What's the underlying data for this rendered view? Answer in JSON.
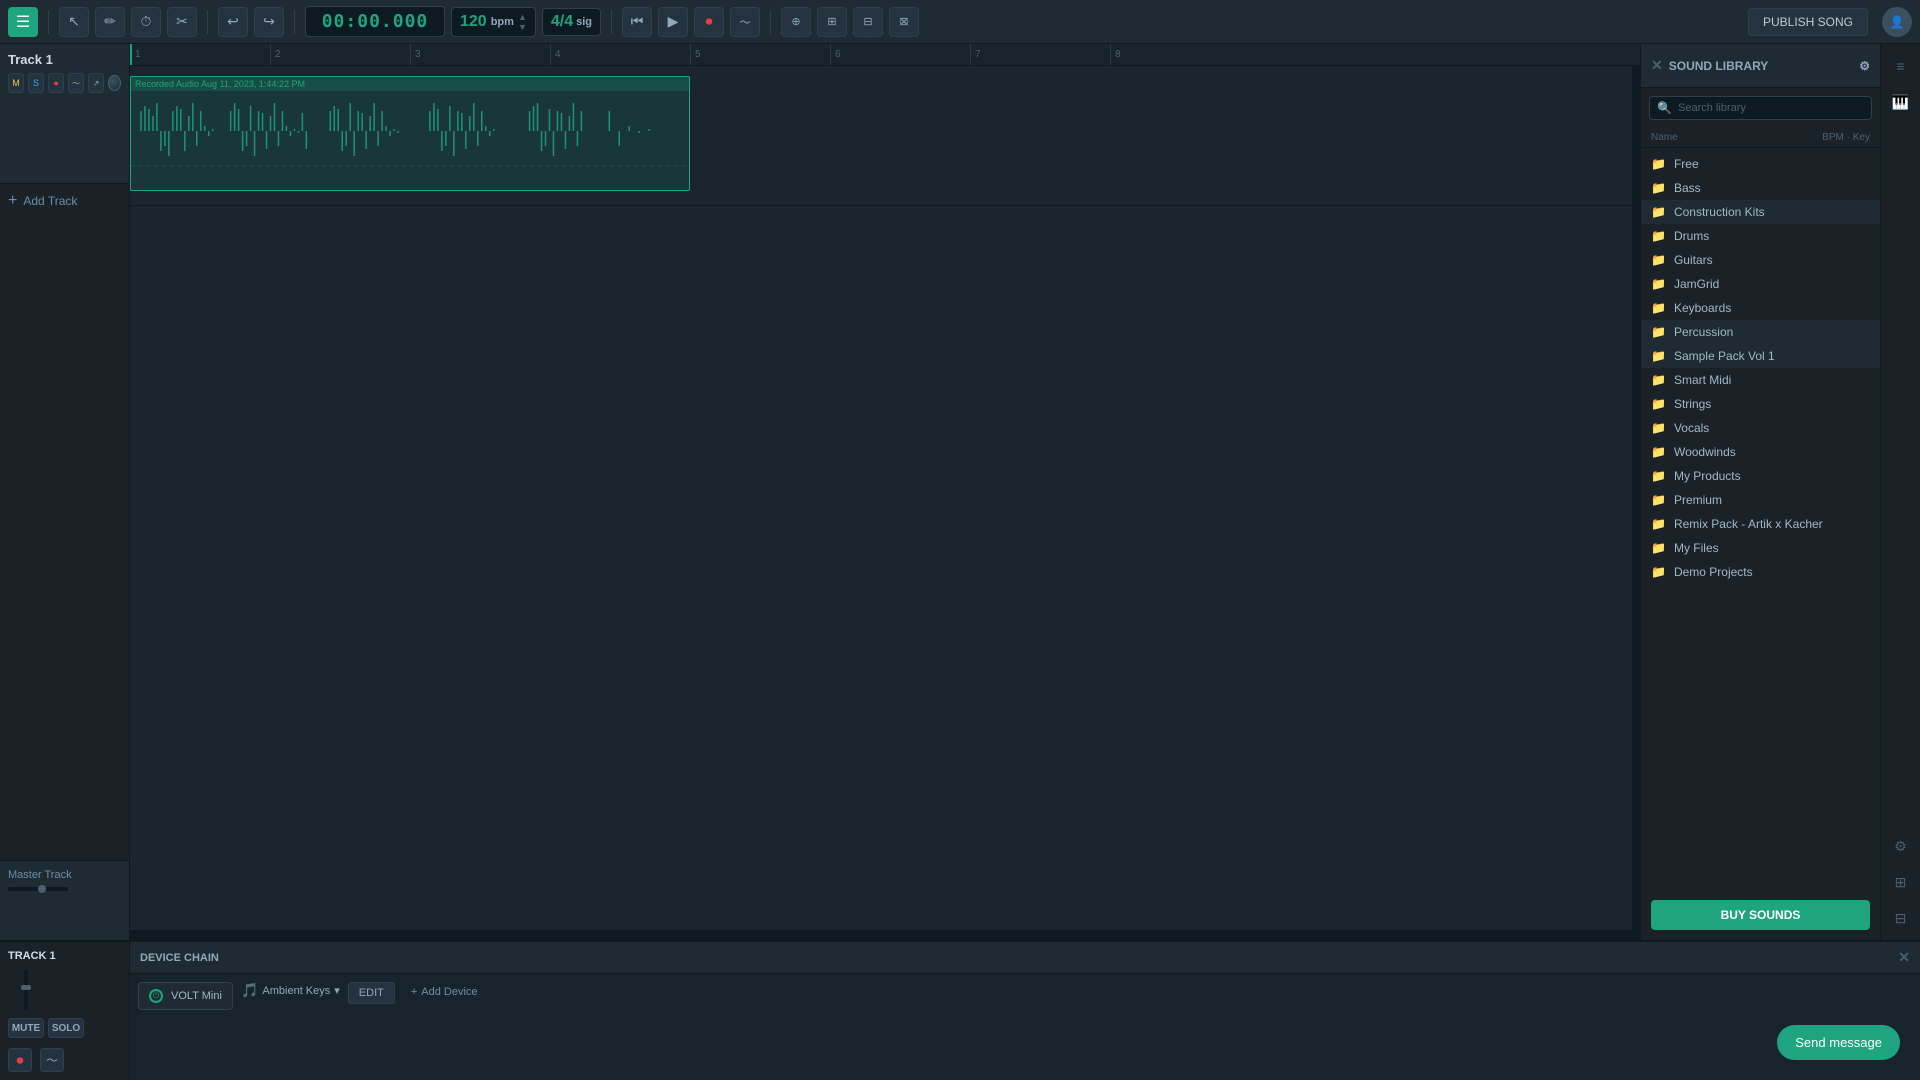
{
  "toolbar": {
    "menu_icon": "☰",
    "tools": [
      {
        "name": "select-tool",
        "icon": "↖",
        "label": "Select"
      },
      {
        "name": "pencil-tool",
        "icon": "✏",
        "label": "Pencil"
      },
      {
        "name": "clock-tool",
        "icon": "⏱",
        "label": "Clock"
      },
      {
        "name": "cut-tool",
        "icon": "✂",
        "label": "Cut"
      },
      {
        "name": "undo-btn",
        "icon": "↩",
        "label": "Undo"
      },
      {
        "name": "redo-btn",
        "icon": "↪",
        "label": "Redo"
      }
    ],
    "transport_time": "00:00.000",
    "bpm": "120",
    "bpm_unit": "bpm",
    "time_sig": "4/4",
    "time_sig_unit": "sig",
    "transport_btns": [
      {
        "name": "go-start-btn",
        "icon": "⏮"
      },
      {
        "name": "play-btn",
        "icon": "▶"
      },
      {
        "name": "record-btn",
        "icon": "⏺"
      },
      {
        "name": "loop-btn",
        "icon": "🔁"
      }
    ],
    "extra_tools": [
      {
        "name": "tool-a",
        "icon": "⊕"
      },
      {
        "name": "tool-b",
        "icon": "⊞"
      },
      {
        "name": "tool-c",
        "icon": "⊟"
      },
      {
        "name": "tool-d",
        "icon": "⊠"
      }
    ],
    "publish_label": "PUBLISH SONG"
  },
  "track1": {
    "name": "Track 1",
    "clip_label": "Recorded Audio Aug 11, 2023, 1:44:22 PM",
    "controls": {
      "m": "M",
      "s": "S",
      "rec": "●",
      "eq": "〜",
      "auto": "↗"
    }
  },
  "add_track_label": "Add Track",
  "master_track_label": "Master Track",
  "timeline": {
    "marks": [
      "1",
      "2",
      "3",
      "4",
      "5",
      "6",
      "7",
      "8"
    ]
  },
  "sound_library": {
    "title": "SOUND LIBRARY",
    "search_placeholder": "Search library",
    "columns": {
      "name": "Name",
      "bpm": "BPM",
      "key": "Key"
    },
    "items": [
      {
        "name": "Free",
        "type": "folder"
      },
      {
        "name": "Bass",
        "type": "folder"
      },
      {
        "name": "Construction Kits",
        "type": "folder"
      },
      {
        "name": "Drums",
        "type": "folder"
      },
      {
        "name": "Guitars",
        "type": "folder"
      },
      {
        "name": "JamGrid",
        "type": "folder"
      },
      {
        "name": "Keyboards",
        "type": "folder"
      },
      {
        "name": "Percussion",
        "type": "folder"
      },
      {
        "name": "Sample Pack Vol 1",
        "type": "folder"
      },
      {
        "name": "Smart Midi",
        "type": "folder"
      },
      {
        "name": "Strings",
        "type": "folder"
      },
      {
        "name": "Vocals",
        "type": "folder"
      },
      {
        "name": "Woodwinds",
        "type": "folder"
      },
      {
        "name": "My Products",
        "type": "folder"
      },
      {
        "name": "Premium",
        "type": "folder"
      },
      {
        "name": "Remix Pack - Artik x Kacher",
        "type": "folder"
      },
      {
        "name": "My Files",
        "type": "folder"
      },
      {
        "name": "Demo Projects",
        "type": "folder"
      }
    ],
    "buy_sounds_label": "BUY SOUNDS"
  },
  "device_chain": {
    "title": "DEVICE CHAIN",
    "close_icon": "✕",
    "device": {
      "power_icon": "⏻",
      "plugin_name": "VOLT Mini",
      "preset_name": "Ambient Keys",
      "dropdown_icon": "▾",
      "edit_label": "EDIT"
    },
    "add_device_icon": "+",
    "add_device_label": "Add Device"
  },
  "bottom_track": {
    "name": "TRACK 1",
    "mute_label": "MUTE",
    "solo_label": "SOLO"
  },
  "send_message_btn": "Send message",
  "right_sidebar": {
    "icons": [
      {
        "name": "mixer-icon",
        "icon": "≡"
      },
      {
        "name": "piano-icon",
        "icon": "🎹"
      },
      {
        "name": "settings-icon",
        "icon": "⚙"
      },
      {
        "name": "grid-icon-a",
        "icon": "⊞"
      },
      {
        "name": "grid-icon-b",
        "icon": "⊟"
      }
    ]
  }
}
